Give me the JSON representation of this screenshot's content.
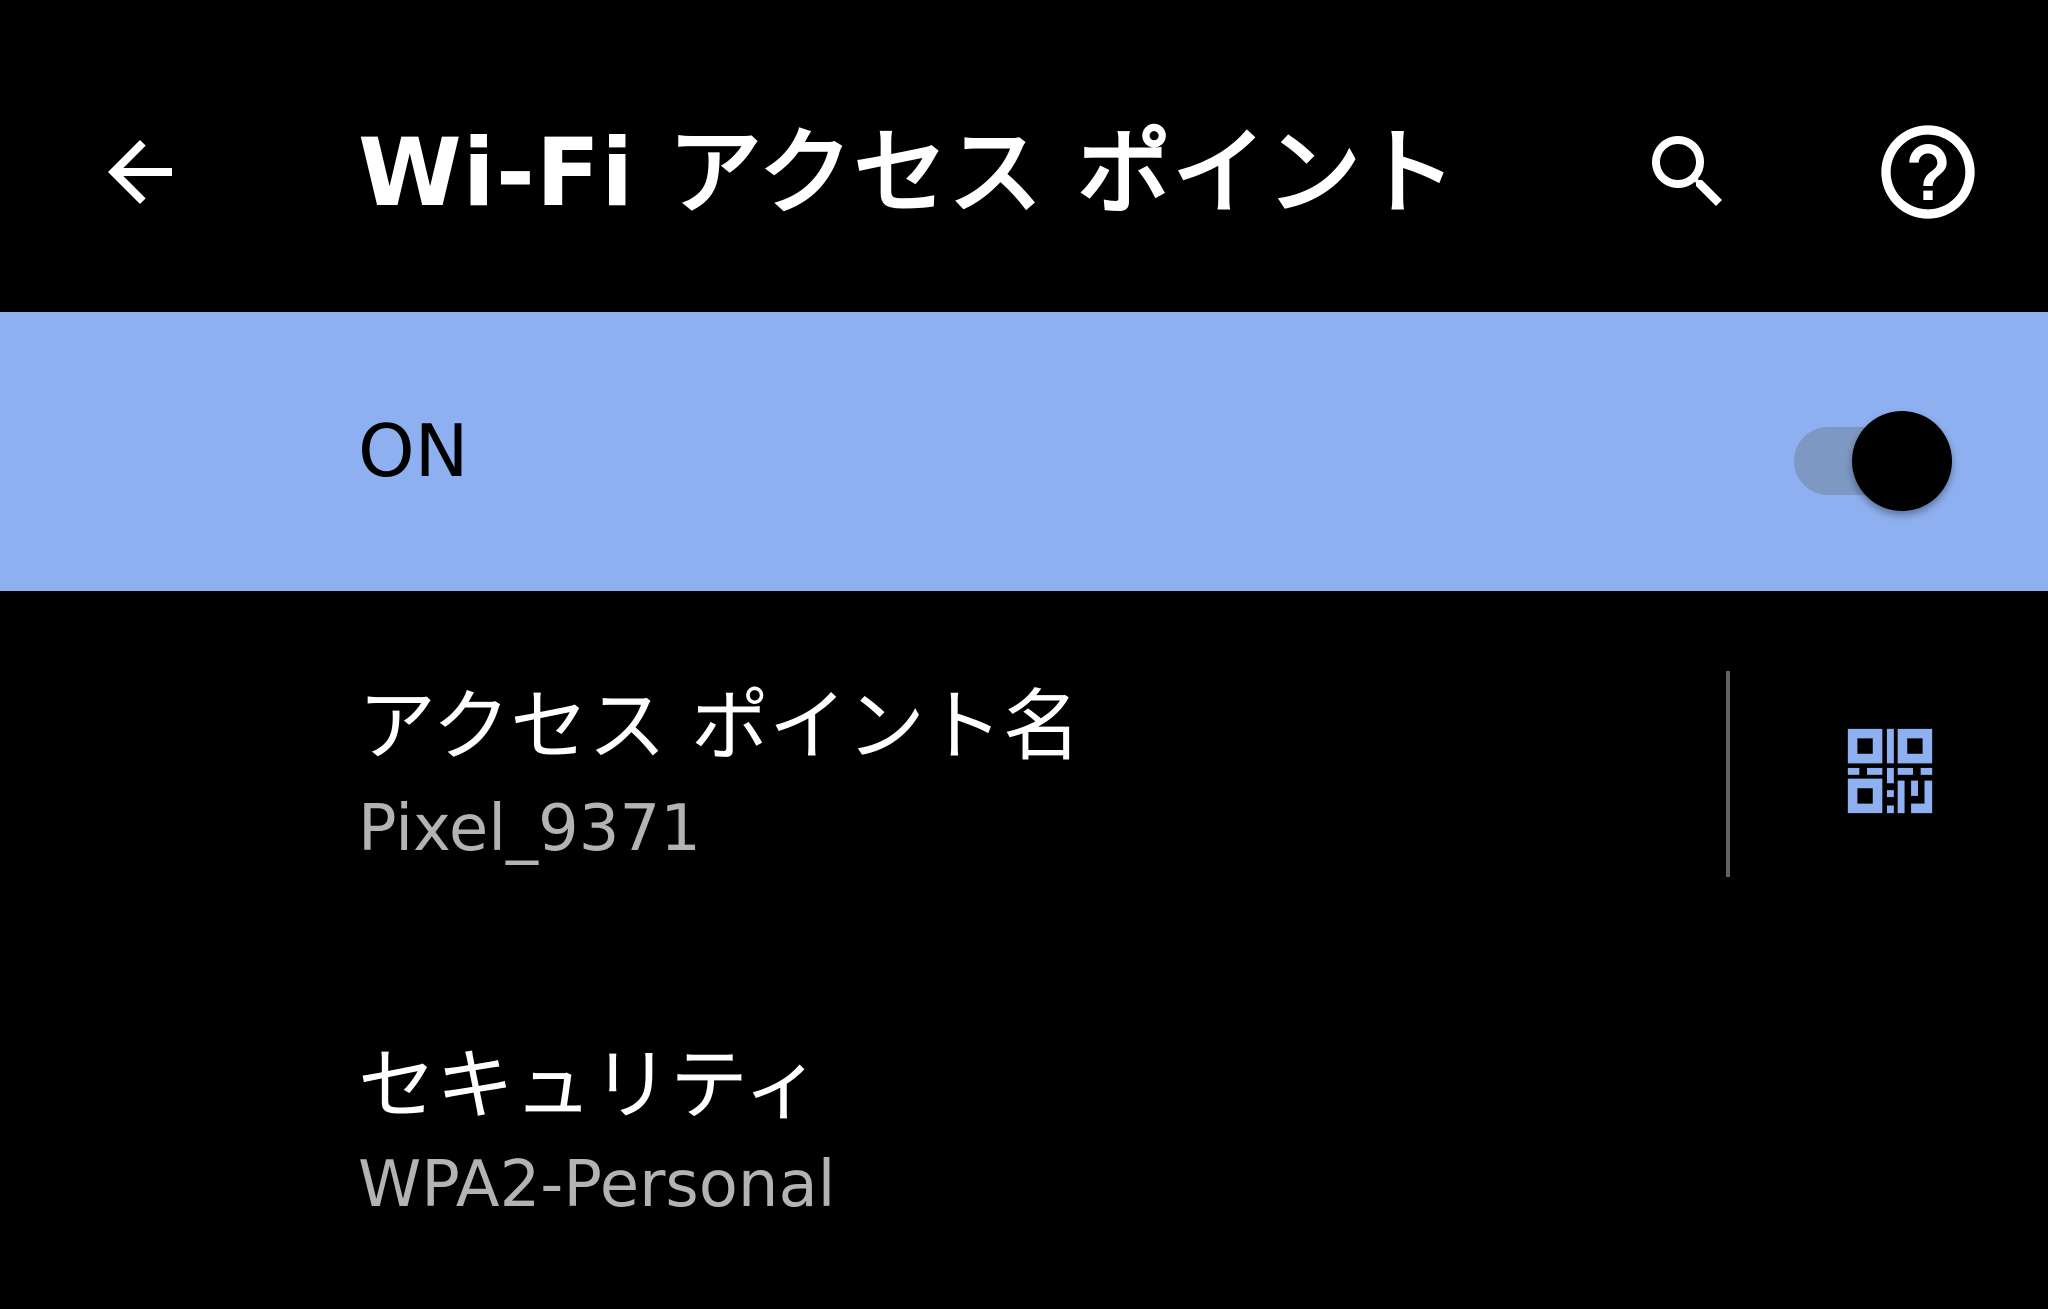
{
  "colors": {
    "background": "#000000",
    "accent": "#8fb0f0",
    "switch_track": "#7e98c4",
    "title_text": "#ffffff",
    "summary_text": "#b3b3b3",
    "qr_icon": "#8fb0f0"
  },
  "app_bar": {
    "title": "Wi-Fi アクセス ポイント",
    "back_icon": "arrow-back-icon",
    "search_icon": "search-icon",
    "help_icon": "help-circle-icon"
  },
  "master_switch": {
    "label": "ON",
    "checked": true
  },
  "settings": [
    {
      "title": "アクセス ポイント名",
      "summary": "Pixel_9371",
      "action_icon": "qr-code-icon"
    },
    {
      "title": "セキュリティ",
      "summary": "WPA2-Personal"
    }
  ]
}
